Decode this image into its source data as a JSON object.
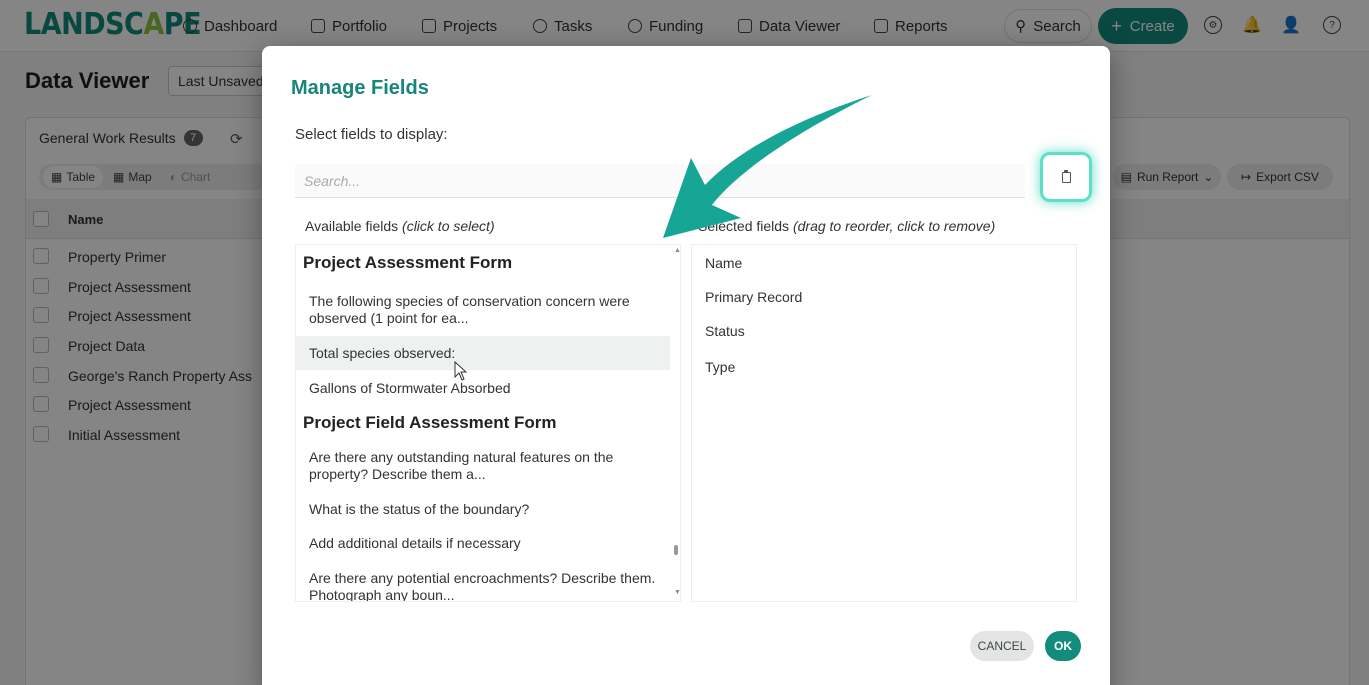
{
  "nav": {
    "logo_main": "LANDSC",
    "logo_leaf": "A",
    "logo_end": "PE",
    "items": [
      {
        "label": "Dashboard",
        "icon": "dashboard-icon"
      },
      {
        "label": "Portfolio",
        "icon": "folder-icon"
      },
      {
        "label": "Projects",
        "icon": "projects-icon"
      },
      {
        "label": "Tasks",
        "icon": "check-circle-icon"
      },
      {
        "label": "Funding",
        "icon": "moneybag-icon"
      },
      {
        "label": "Data Viewer",
        "icon": "table-icon"
      },
      {
        "label": "Reports",
        "icon": "document-icon"
      }
    ],
    "search_label": "Search",
    "create_label": "Create"
  },
  "page": {
    "title": "Data Viewer",
    "view_select": "Last Unsaved",
    "card_title": "General Work Results",
    "count": "7",
    "tabs": {
      "table": "Table",
      "map": "Map",
      "chart": "Chart"
    },
    "run_report": "Run Report",
    "export_csv": "Export CSV",
    "column_name": "Name",
    "rows": [
      "Property Primer",
      "Project Assessment",
      "Project Assessment",
      "Project Data",
      "George's Ranch Property Ass",
      "Project Assessment",
      "Initial Assessment"
    ]
  },
  "modal": {
    "title": "Manage Fields",
    "subtitle": "Select fields to display:",
    "search_placeholder": "Search...",
    "available_label": "Available fields",
    "available_hint": "(click to select)",
    "selected_label": "Selected fields",
    "selected_hint": "(drag to reorder, click to remove)",
    "groups": [
      {
        "title": "Project Assessment Form",
        "fields": [
          "The following species of conservation concern were observed (1 point for ea...",
          "Total species observed:",
          "Gallons of Stormwater Absorbed"
        ]
      },
      {
        "title": "Project Field Assessment Form",
        "fields": [
          "Are there any outstanding natural features on the property? Describe them a...",
          "What is the status of the boundary?",
          "Add additional details if necessary",
          "Are there any potential encroachments? Describe them. Photograph any boun..."
        ]
      }
    ],
    "selected_fields": [
      "Name",
      "Primary Record",
      "Status",
      "Type"
    ],
    "cancel_label": "CANCEL",
    "ok_label": "OK"
  },
  "colors": {
    "brand": "#138c7e",
    "highlight": "#5de0c6",
    "arrow": "#17a596"
  }
}
